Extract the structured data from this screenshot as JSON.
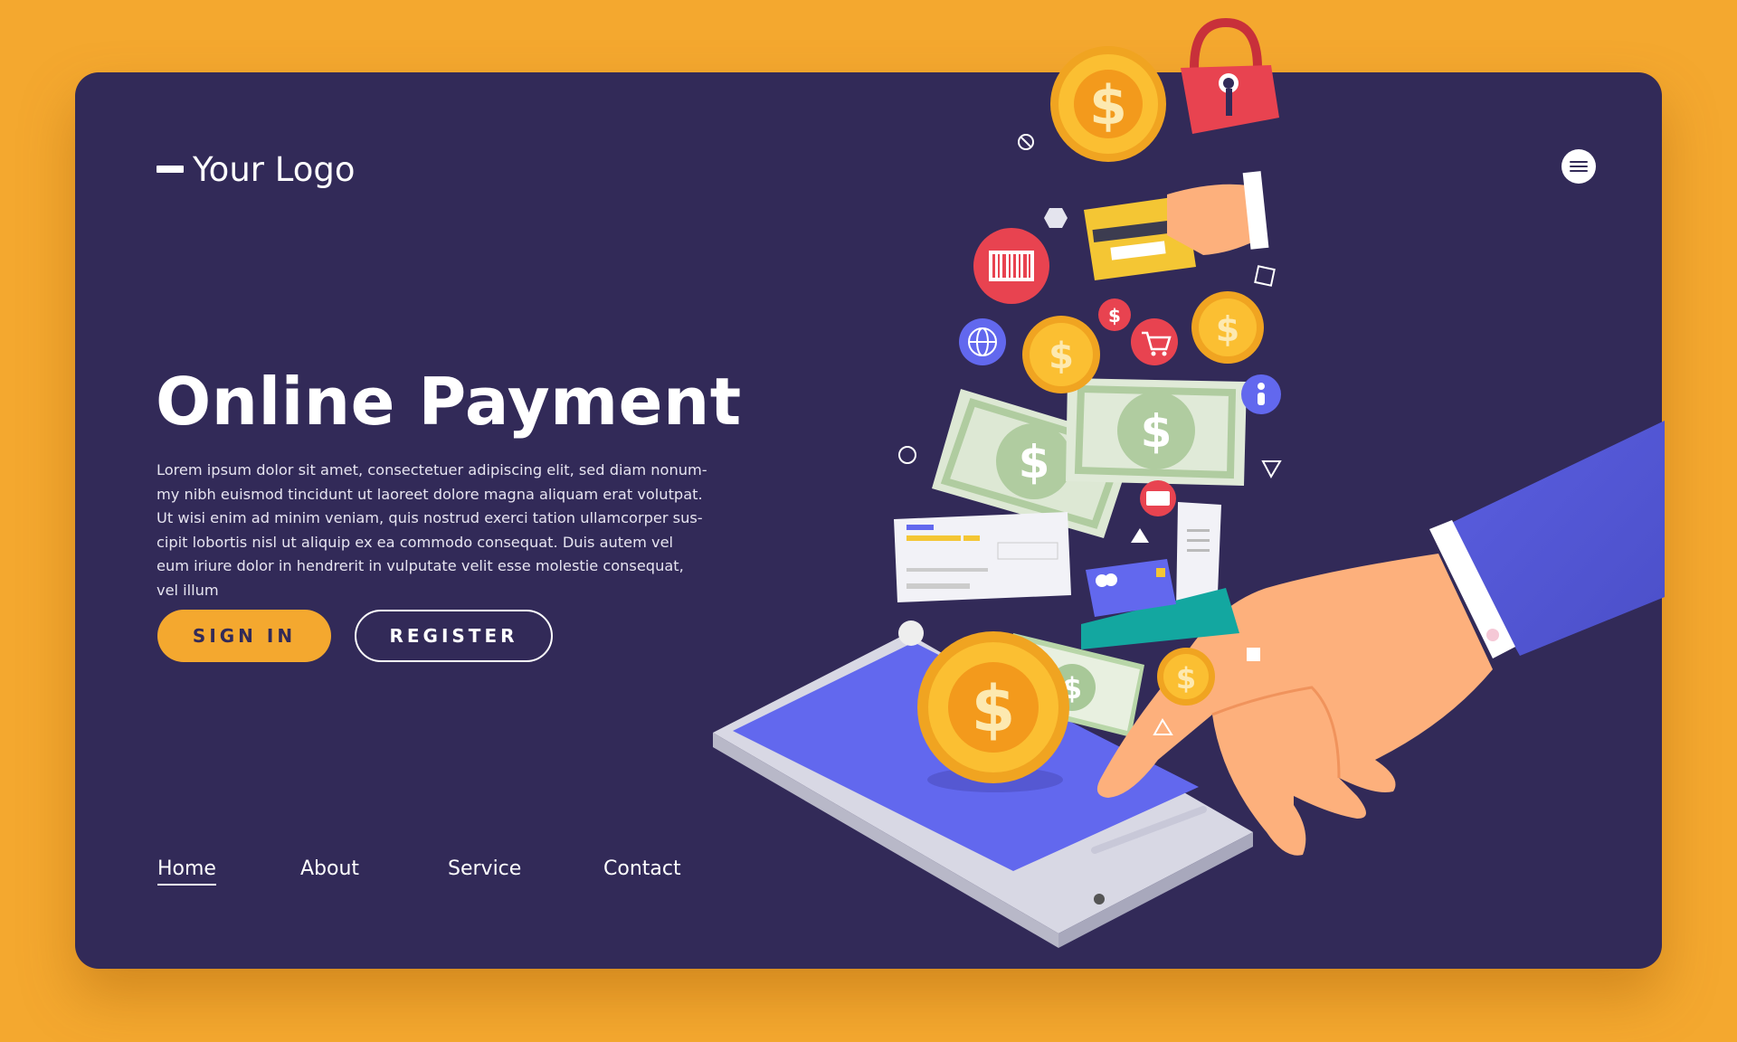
{
  "header": {
    "logo_text": "Your Logo",
    "menu_icon": "hamburger-menu-icon"
  },
  "hero": {
    "title": "Online Payment",
    "body": "Lorem ipsum dolor sit amet, consectetuer adipiscing elit, sed diam nonum-my nibh euismod tincidunt ut laoreet dolore magna aliquam erat volutpat. Ut wisi enim ad minim veniam, quis nostrud exerci tation ullamcorper sus-cipit lobortis nisl ut aliquip ex ea commodo consequat. Duis autem vel eum iriure dolor in hendrerit in vulputate velit esse molestie consequat, vel illum"
  },
  "buttons": {
    "signin_label": "SIGN IN",
    "register_label": "REGISTER"
  },
  "nav": {
    "items": [
      {
        "label": "Home",
        "active": true
      },
      {
        "label": "About",
        "active": false
      },
      {
        "label": "Service",
        "active": false
      },
      {
        "label": "Contact",
        "active": false
      }
    ]
  },
  "illustration": {
    "coin_symbol": "$",
    "icons": [
      "phone-icon",
      "hand-icon",
      "coin-icon",
      "banknote-icon",
      "credit-card-icon",
      "padlock-icon",
      "barcode-icon",
      "globe-icon",
      "cart-icon",
      "receipt-icon",
      "cheque-icon",
      "info-icon"
    ]
  },
  "colors": {
    "background": "#f4a82f",
    "card": "#322a58",
    "accent": "#f4a82f",
    "phone_screen": "#6268ee"
  }
}
